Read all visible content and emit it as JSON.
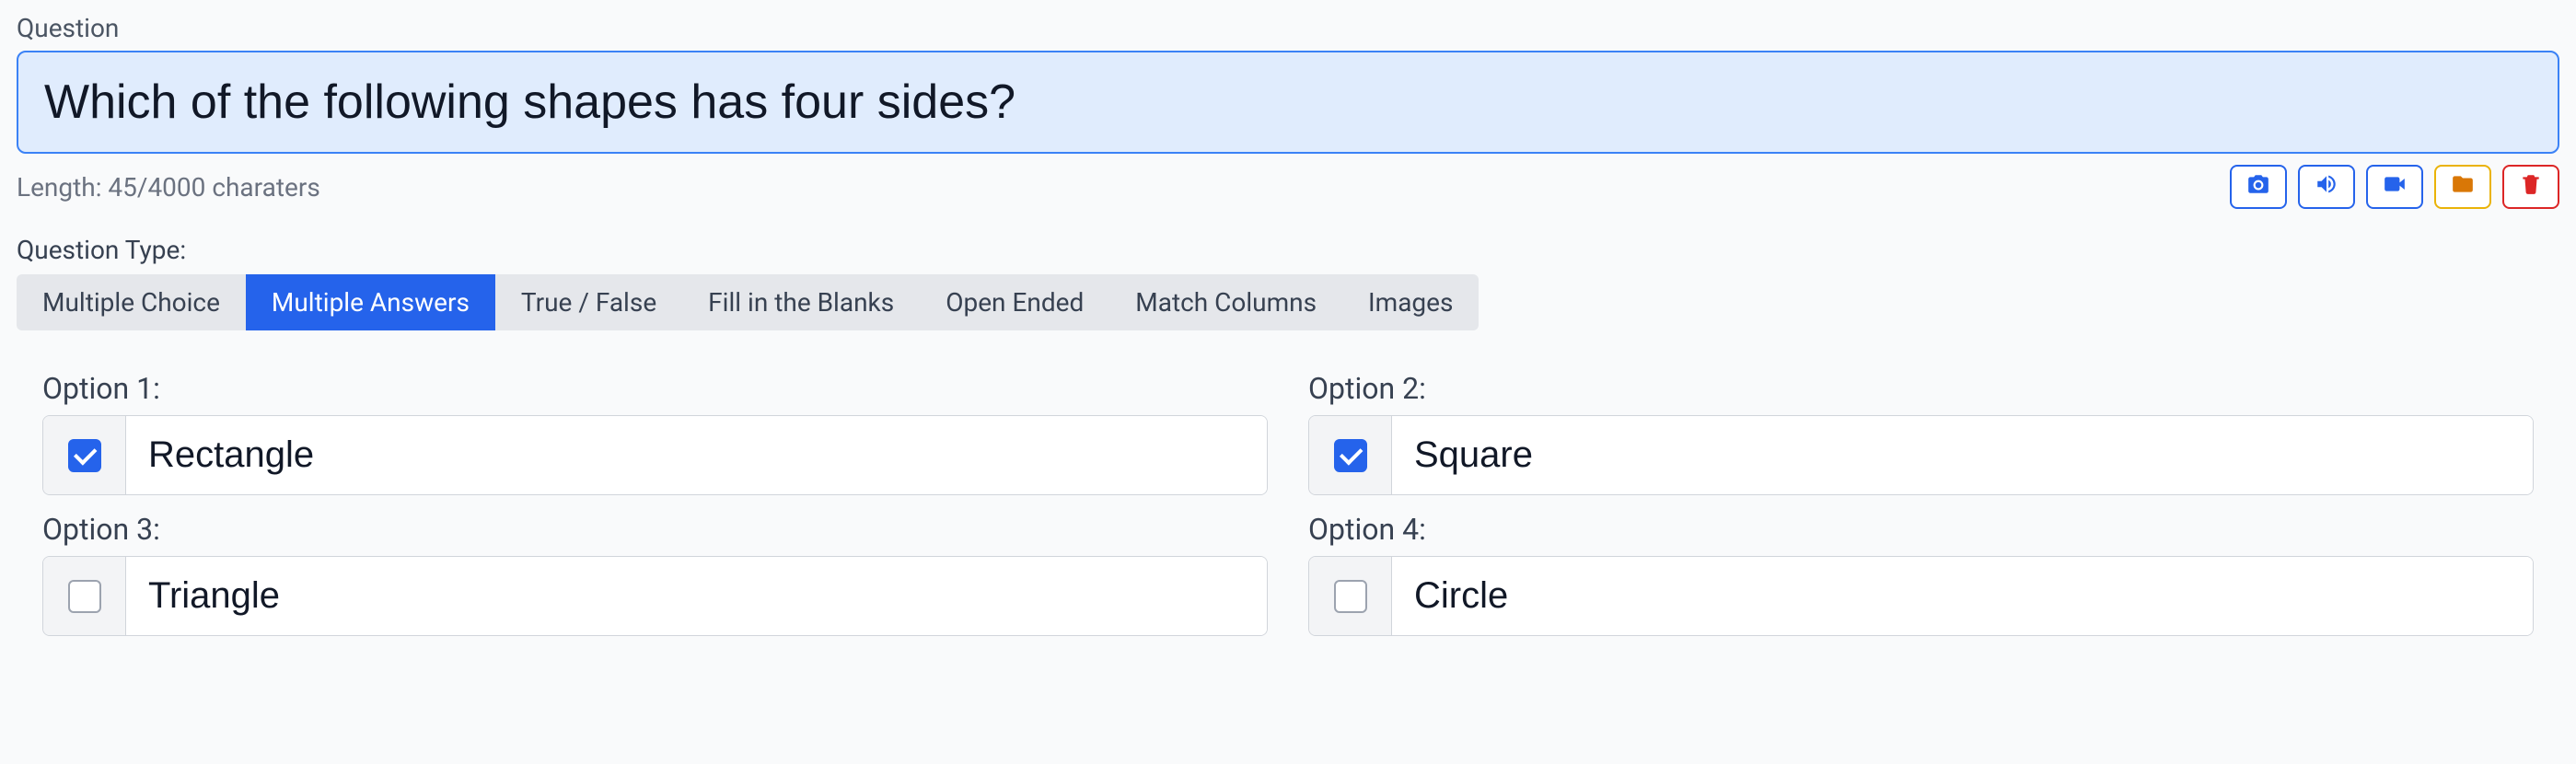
{
  "question": {
    "label": "Question",
    "value": "Which of the following shapes has four sides?",
    "lengthText": "Length: 45/4000 charaters"
  },
  "questionType": {
    "label": "Question Type:",
    "tabs": [
      {
        "label": "Multiple Choice",
        "active": false
      },
      {
        "label": "Multiple Answers",
        "active": true
      },
      {
        "label": "True / False",
        "active": false
      },
      {
        "label": "Fill in the Blanks",
        "active": false
      },
      {
        "label": "Open Ended",
        "active": false
      },
      {
        "label": "Match Columns",
        "active": false
      },
      {
        "label": "Images",
        "active": false
      }
    ]
  },
  "options": [
    {
      "label": "Option 1:",
      "value": "Rectangle",
      "checked": true
    },
    {
      "label": "Option 2:",
      "value": "Square",
      "checked": true
    },
    {
      "label": "Option 3:",
      "value": "Triangle",
      "checked": false
    },
    {
      "label": "Option 4:",
      "value": "Circle",
      "checked": false
    }
  ]
}
